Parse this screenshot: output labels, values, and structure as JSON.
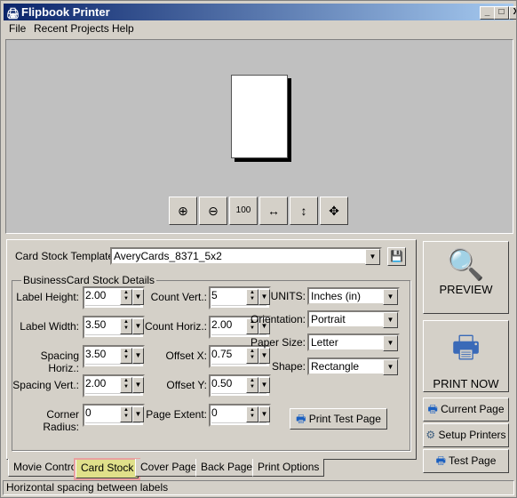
{
  "window": {
    "title": "Flipbook Printer",
    "controls": [
      "_",
      "□",
      "X"
    ]
  },
  "menu": [
    "File",
    "Recent Projects",
    "Help"
  ],
  "preview": {
    "zoom_buttons": [
      "zoom-in-icon",
      "zoom-out-icon",
      "zoom-100-icon",
      "fit-width-icon",
      "fit-height-icon",
      "fit-page-icon"
    ]
  },
  "template": {
    "label": "Card Stock Template:",
    "value": "AveryCards_8371_5x2"
  },
  "group": {
    "title": "BusinessCard Stock Details"
  },
  "fields": [
    {
      "label": "Label Height:",
      "value": "2.00"
    },
    {
      "label": "Label Width:",
      "value": "3.50"
    },
    {
      "label": "Spacing Horiz.:",
      "value": "3.50"
    },
    {
      "label": "Spacing Vert.:",
      "value": "2.00"
    },
    {
      "label": "Corner Radius:",
      "value": "0"
    },
    {
      "label": "Count Vert.:",
      "value": "5"
    },
    {
      "label": "Count Horiz.:",
      "value": "2.00"
    },
    {
      "label": "Offset X:",
      "value": "0.75"
    },
    {
      "label": "Offset Y:",
      "value": "0.50"
    },
    {
      "label": "Page Extent:",
      "value": "0"
    }
  ],
  "selects": [
    {
      "label": "UNITS:",
      "value": "Inches (in)"
    },
    {
      "label": "Orientation:",
      "value": "Portrait"
    },
    {
      "label": "Paper Size:",
      "value": "Letter"
    },
    {
      "label": "Shape:",
      "value": "Rectangle"
    }
  ],
  "print_test_page": "Print Test Page",
  "side_buttons": {
    "preview": "PREVIEW",
    "print_now": "PRINT NOW",
    "current_page": "Current Page",
    "setup_printers": "Setup Printers",
    "test_page": "Test Page"
  },
  "tabs": [
    "Movie Control",
    "Card Stock",
    "Cover Page",
    "Back Page",
    "Print Options"
  ],
  "active_tab": "Card Stock",
  "status": "Horizontal spacing between labels"
}
